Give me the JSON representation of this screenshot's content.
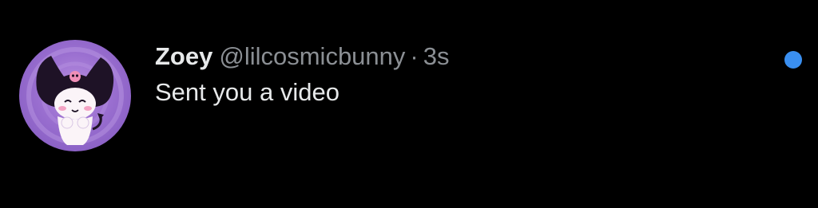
{
  "conversation": {
    "display_name": "Zoey",
    "handle": "@lilcosmicbunny",
    "separator": "·",
    "timestamp": "3s",
    "preview": "Sent you a video",
    "avatar_icon": "kuromi-avatar",
    "unread": true,
    "unread_color": "#3a8ff0"
  }
}
